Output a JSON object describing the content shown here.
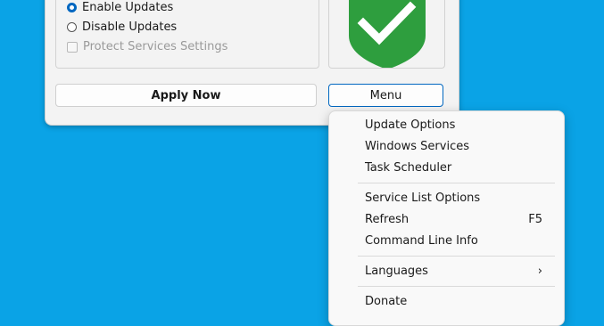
{
  "options": {
    "enable_updates": "Enable Updates",
    "disable_updates": "Disable Updates",
    "protect_services": "Protect Services Settings",
    "selected": "enable_updates"
  },
  "buttons": {
    "apply_now": "Apply Now",
    "menu": "Menu"
  },
  "status_icon": "shield-check-icon",
  "colors": {
    "desktop": "#0aa3e6",
    "shield": "#2e9e3e",
    "accent": "#0067c0"
  },
  "menu": {
    "group1": [
      "Update Options",
      "Windows Services",
      "Task Scheduler"
    ],
    "group2": [
      {
        "label": "Service List Options",
        "shortcut": ""
      },
      {
        "label": "Refresh",
        "shortcut": "F5"
      },
      {
        "label": "Command Line Info",
        "shortcut": ""
      }
    ],
    "languages": "Languages",
    "languages_arrow": "›",
    "donate": "Donate"
  }
}
